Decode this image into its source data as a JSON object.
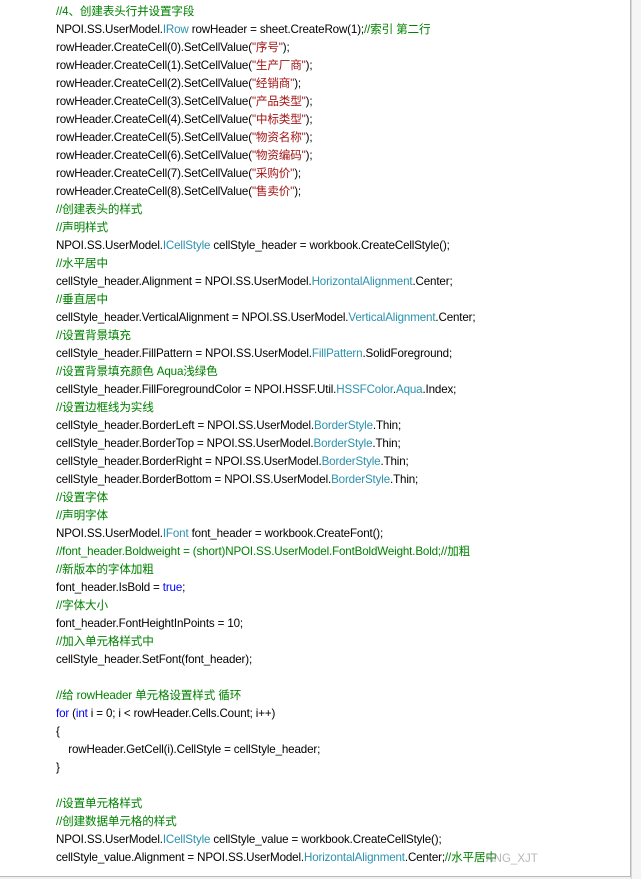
{
  "colors": {
    "plain": "#000000",
    "comment": "#008000",
    "type": "#2b91af",
    "string": "#a31515",
    "keyword": "#0000ff"
  },
  "watermark": "ANG_XJT",
  "lines": [
    [
      [
        "comment",
        "//4、创建表头行并设置字段"
      ]
    ],
    [
      [
        "plain",
        "NPOI.SS.UserModel."
      ],
      [
        "type",
        "IRow"
      ],
      [
        "plain",
        " rowHeader = sheet.CreateRow(1);"
      ],
      [
        "comment",
        "//索引 第二行"
      ]
    ],
    [
      [
        "plain",
        "rowHeader.CreateCell(0).SetCellValue("
      ],
      [
        "string",
        "\"序号\""
      ],
      [
        "plain",
        ");"
      ]
    ],
    [
      [
        "plain",
        "rowHeader.CreateCell(1).SetCellValue("
      ],
      [
        "string",
        "\"生产厂商\""
      ],
      [
        "plain",
        ");"
      ]
    ],
    [
      [
        "plain",
        "rowHeader.CreateCell(2).SetCellValue("
      ],
      [
        "string",
        "\"经销商\""
      ],
      [
        "plain",
        ");"
      ]
    ],
    [
      [
        "plain",
        "rowHeader.CreateCell(3).SetCellValue("
      ],
      [
        "string",
        "\"产品类型\""
      ],
      [
        "plain",
        ");"
      ]
    ],
    [
      [
        "plain",
        "rowHeader.CreateCell(4).SetCellValue("
      ],
      [
        "string",
        "\"中标类型\""
      ],
      [
        "plain",
        ");"
      ]
    ],
    [
      [
        "plain",
        "rowHeader.CreateCell(5).SetCellValue("
      ],
      [
        "string",
        "\"物资名称\""
      ],
      [
        "plain",
        ");"
      ]
    ],
    [
      [
        "plain",
        "rowHeader.CreateCell(6).SetCellValue("
      ],
      [
        "string",
        "\"物资编码\""
      ],
      [
        "plain",
        ");"
      ]
    ],
    [
      [
        "plain",
        "rowHeader.CreateCell(7).SetCellValue("
      ],
      [
        "string",
        "\"采购价\""
      ],
      [
        "plain",
        ");"
      ]
    ],
    [
      [
        "plain",
        "rowHeader.CreateCell(8).SetCellValue("
      ],
      [
        "string",
        "\"售卖价\""
      ],
      [
        "plain",
        ");"
      ]
    ],
    [
      [
        "comment",
        "//创建表头的样式"
      ]
    ],
    [
      [
        "comment",
        "//声明样式"
      ]
    ],
    [
      [
        "plain",
        "NPOI.SS.UserModel."
      ],
      [
        "type",
        "ICellStyle"
      ],
      [
        "plain",
        " cellStyle_header = workbook.CreateCellStyle();"
      ]
    ],
    [
      [
        "comment",
        "//水平居中"
      ]
    ],
    [
      [
        "plain",
        "cellStyle_header.Alignment = NPOI.SS.UserModel."
      ],
      [
        "type",
        "HorizontalAlignment"
      ],
      [
        "plain",
        ".Center;"
      ]
    ],
    [
      [
        "comment",
        "//垂直居中"
      ]
    ],
    [
      [
        "plain",
        "cellStyle_header.VerticalAlignment = NPOI.SS.UserModel."
      ],
      [
        "type",
        "VerticalAlignment"
      ],
      [
        "plain",
        ".Center;"
      ]
    ],
    [
      [
        "comment",
        "//设置背景填充"
      ]
    ],
    [
      [
        "plain",
        "cellStyle_header.FillPattern = NPOI.SS.UserModel."
      ],
      [
        "type",
        "FillPattern"
      ],
      [
        "plain",
        ".SolidForeground;"
      ]
    ],
    [
      [
        "comment",
        "//设置背景填充颜色 Aqua浅绿色"
      ]
    ],
    [
      [
        "plain",
        "cellStyle_header.FillForegroundColor = NPOI.HSSF.Util."
      ],
      [
        "type",
        "HSSFColor"
      ],
      [
        "plain",
        "."
      ],
      [
        "type",
        "Aqua"
      ],
      [
        "plain",
        ".Index;"
      ]
    ],
    [
      [
        "comment",
        "//设置边框线为实线"
      ]
    ],
    [
      [
        "plain",
        "cellStyle_header.BorderLeft = NPOI.SS.UserModel."
      ],
      [
        "type",
        "BorderStyle"
      ],
      [
        "plain",
        ".Thin;"
      ]
    ],
    [
      [
        "plain",
        "cellStyle_header.BorderTop = NPOI.SS.UserModel."
      ],
      [
        "type",
        "BorderStyle"
      ],
      [
        "plain",
        ".Thin;"
      ]
    ],
    [
      [
        "plain",
        "cellStyle_header.BorderRight = NPOI.SS.UserModel."
      ],
      [
        "type",
        "BorderStyle"
      ],
      [
        "plain",
        ".Thin;"
      ]
    ],
    [
      [
        "plain",
        "cellStyle_header.BorderBottom = NPOI.SS.UserModel."
      ],
      [
        "type",
        "BorderStyle"
      ],
      [
        "plain",
        ".Thin;"
      ]
    ],
    [
      [
        "comment",
        "//设置字体"
      ]
    ],
    [
      [
        "comment",
        "//声明字体"
      ]
    ],
    [
      [
        "plain",
        "NPOI.SS.UserModel."
      ],
      [
        "type",
        "IFont"
      ],
      [
        "plain",
        " font_header = workbook.CreateFont();"
      ]
    ],
    [
      [
        "comment",
        "//font_header.Boldweight = (short)NPOI.SS.UserModel.FontBoldWeight.Bold;//加粗"
      ]
    ],
    [
      [
        "comment",
        "//新版本的字体加粗"
      ]
    ],
    [
      [
        "plain",
        "font_header.IsBold = "
      ],
      [
        "keyword",
        "true"
      ],
      [
        "plain",
        ";"
      ]
    ],
    [
      [
        "comment",
        "//字体大小"
      ]
    ],
    [
      [
        "plain",
        "font_header.FontHeightInPoints = 10;"
      ]
    ],
    [
      [
        "comment",
        "//加入单元格样式中"
      ]
    ],
    [
      [
        "plain",
        "cellStyle_header.SetFont(font_header);"
      ]
    ],
    [
      [
        "plain",
        ""
      ]
    ],
    [
      [
        "comment",
        "//给 rowHeader 单元格设置样式 循环"
      ]
    ],
    [
      [
        "keyword",
        "for"
      ],
      [
        "plain",
        " ("
      ],
      [
        "keyword",
        "int"
      ],
      [
        "plain",
        " i = 0; i < rowHeader.Cells.Count; i++)"
      ]
    ],
    [
      [
        "plain",
        "{"
      ]
    ],
    [
      [
        "plain",
        "    rowHeader.GetCell(i).CellStyle = cellStyle_header;"
      ]
    ],
    [
      [
        "plain",
        "}"
      ]
    ],
    [
      [
        "plain",
        ""
      ]
    ],
    [
      [
        "comment",
        "//设置单元格样式"
      ]
    ],
    [
      [
        "comment",
        "//创建数据单元格的样式"
      ]
    ],
    [
      [
        "plain",
        "NPOI.SS.UserModel."
      ],
      [
        "type",
        "ICellStyle"
      ],
      [
        "plain",
        " cellStyle_value = workbook.CreateCellStyle();"
      ]
    ],
    [
      [
        "plain",
        "cellStyle_value.Alignment = NPOI.SS.UserModel."
      ],
      [
        "type",
        "HorizontalAlignment"
      ],
      [
        "plain",
        ".Center;"
      ],
      [
        "comment",
        "//水平居中"
      ]
    ]
  ]
}
